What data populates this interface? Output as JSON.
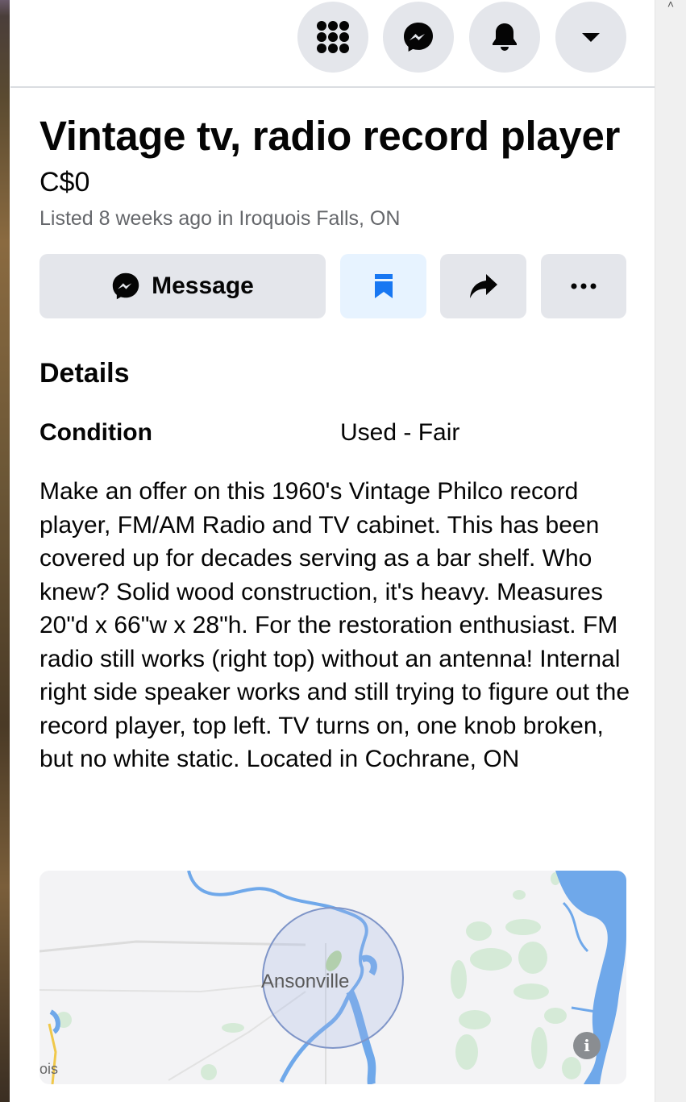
{
  "listing": {
    "title": "Vintage tv, radio record player",
    "price": "C$0",
    "listed": "Listed 8 weeks ago in Iroquois Falls, ON"
  },
  "actions": {
    "message_label": "Message"
  },
  "details": {
    "heading": "Details",
    "condition_label": "Condition",
    "condition_value": "Used - Fair",
    "description": "Make an offer on this 1960's Vintage Philco record player, FM/AM Radio and TV cabinet.  This has been covered up for decades serving as a bar shelf.  Who knew?  Solid wood construction, it's heavy. Measures 20\"d x 66\"w x 28\"h. For the restoration enthusiast. FM radio still works (right top) without an antenna! Internal right side speaker works and still trying to figure out the record player, top left.  TV turns on, one knob broken, but no white static. Located in Cochrane, ON"
  },
  "map": {
    "place_label": "Ansonville",
    "partial_label": "ois"
  },
  "topbar": {
    "icons": [
      "menu-grid-icon",
      "messenger-icon",
      "notifications-bell-icon",
      "account-dropdown-icon"
    ]
  },
  "colors": {
    "button_gray": "#e4e6eb",
    "save_bg": "#e7f3ff",
    "facebook_blue": "#1877f2",
    "secondary_text": "#65676b",
    "water": "#6fa8ea",
    "park": "#cfe8d3"
  }
}
